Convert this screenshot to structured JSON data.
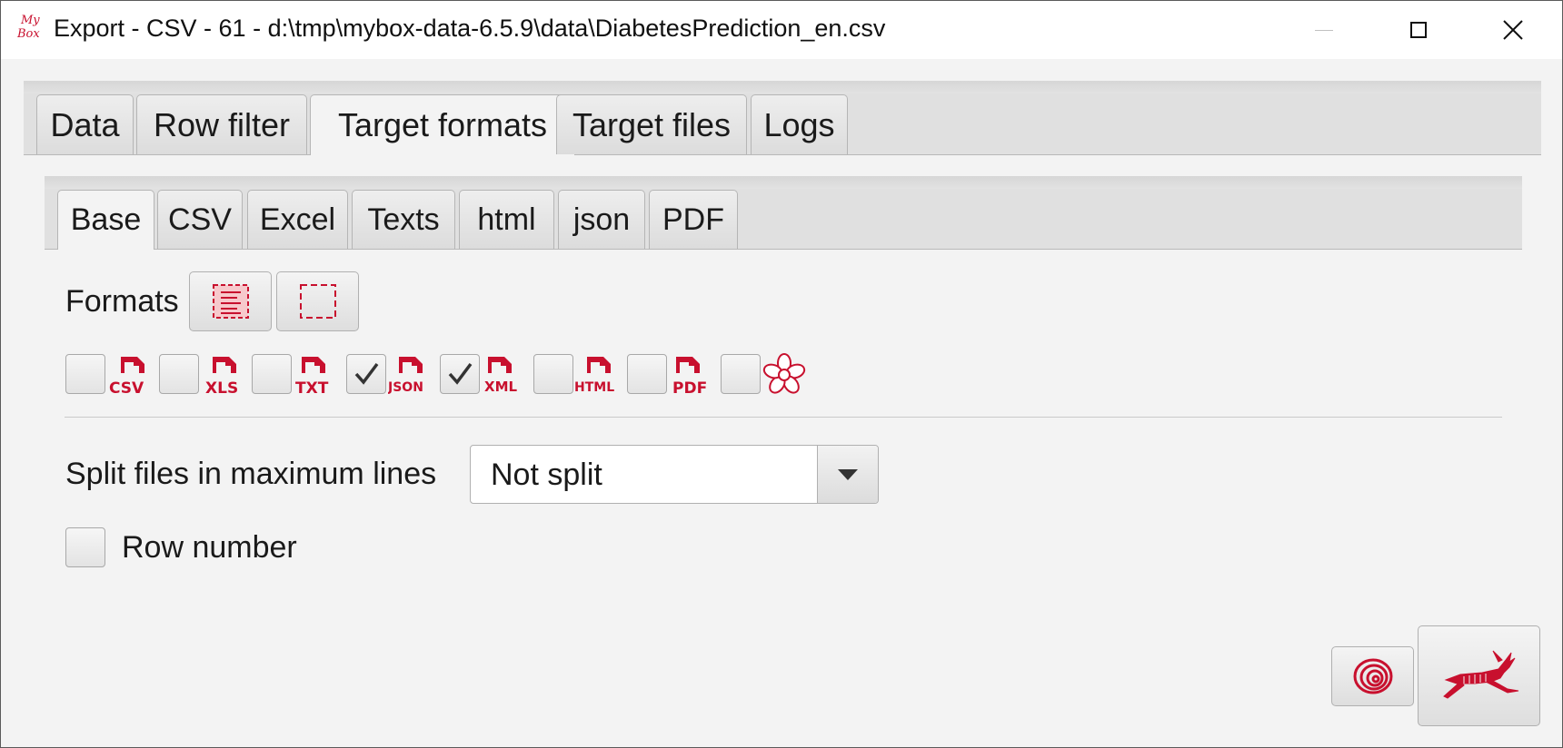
{
  "window": {
    "title": "Export - CSV - 61 - d:\\tmp\\mybox-data-6.5.9\\data\\DiabetesPrediction_en.csv",
    "logo_line1": "My",
    "logo_line2": "Box"
  },
  "outer_tabs": [
    {
      "label": "Data",
      "selected": false
    },
    {
      "label": "Row filter",
      "selected": false
    },
    {
      "label": "Target formats",
      "selected": true
    },
    {
      "label": "Target files",
      "selected": false
    },
    {
      "label": "Logs",
      "selected": false
    }
  ],
  "inner_tabs": [
    {
      "label": "Base",
      "selected": true
    },
    {
      "label": "CSV",
      "selected": false
    },
    {
      "label": "Excel",
      "selected": false
    },
    {
      "label": "Texts",
      "selected": false
    },
    {
      "label": "html",
      "selected": false
    },
    {
      "label": "json",
      "selected": false
    },
    {
      "label": "PDF",
      "selected": false
    }
  ],
  "formats": {
    "label": "Formats",
    "select_all_icon": "select-all-icon",
    "select_none_icon": "select-none-icon",
    "options": [
      {
        "icon": "csv-file-icon",
        "badge": "CSV",
        "checked": false
      },
      {
        "icon": "xls-file-icon",
        "badge": "XLS",
        "checked": false
      },
      {
        "icon": "txt-file-icon",
        "badge": "TXT",
        "checked": false
      },
      {
        "icon": "json-file-icon",
        "badge": "JSON",
        "checked": true
      },
      {
        "icon": "xml-file-icon",
        "badge": "XML",
        "checked": true
      },
      {
        "icon": "html-file-icon",
        "badge": "HTML",
        "checked": false
      },
      {
        "icon": "pdf-file-icon",
        "badge": "PDF",
        "checked": false
      },
      {
        "icon": "flower-icon",
        "badge": "",
        "checked": false
      }
    ]
  },
  "split": {
    "label": "Split files in maximum lines",
    "value": "Not split"
  },
  "row_number": {
    "label": "Row number",
    "checked": false
  },
  "accent_color": "#c8102e"
}
